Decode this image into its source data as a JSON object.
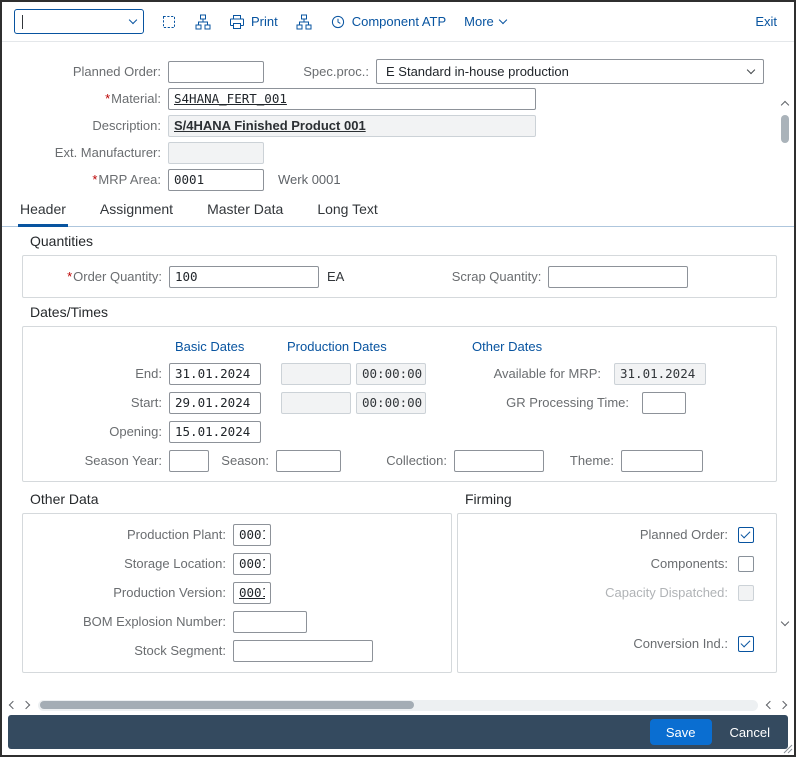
{
  "toolbar": {
    "combobox": {
      "value": ""
    },
    "buttons": {
      "print": "Print",
      "component_atp": "Component ATP",
      "more": "More",
      "exit": "Exit"
    }
  },
  "icons": {
    "toolbar": [
      "dotted-square-icon",
      "hierarchy-icon",
      "printer-icon",
      "hierarchy-icon",
      "clock-icon"
    ],
    "chevron": "chevron-down-icon"
  },
  "header_form": {
    "required_mark": "*",
    "planned_order": {
      "label": "Planned Order:",
      "value": ""
    },
    "spec_proc": {
      "label": "Spec.proc.:",
      "value": "E Standard in-house production"
    },
    "material": {
      "label": "Material:",
      "value": "S4HANA_FERT_001"
    },
    "description": {
      "label": "Description:",
      "value": "S/4HANA Finished Product 001"
    },
    "ext_manufacturer": {
      "label": "Ext. Manufacturer:",
      "value": ""
    },
    "mrp_area": {
      "label": "MRP Area:",
      "value": "0001",
      "plant_text": "Werk 0001"
    }
  },
  "tabs": {
    "items": [
      {
        "label": "Header",
        "selected": true
      },
      {
        "label": "Assignment",
        "selected": false
      },
      {
        "label": "Master Data",
        "selected": false
      },
      {
        "label": "Long Text",
        "selected": false
      }
    ]
  },
  "quantities": {
    "title": "Quantities",
    "order_quantity": {
      "label": "Order Quantity:",
      "value": "100",
      "unit": "EA"
    },
    "scrap_quantity": {
      "label": "Scrap Quantity:",
      "value": ""
    }
  },
  "dates_times": {
    "title": "Dates/Times",
    "col_basic": "Basic Dates",
    "col_production": "Production Dates",
    "col_other": "Other Dates",
    "end": {
      "label": "End:",
      "basic": "31.01.2024",
      "production": "",
      "time": "00:00:00"
    },
    "start": {
      "label": "Start:",
      "basic": "29.01.2024",
      "production": "",
      "time": "00:00:00"
    },
    "opening": {
      "label": "Opening:",
      "basic": "15.01.2024"
    },
    "available_for_mrp": {
      "label": "Available for MRP:",
      "value": "31.01.2024"
    },
    "gr_processing_time": {
      "label": "GR Processing Time:",
      "value": ""
    },
    "season_year": {
      "label": "Season Year:",
      "value": ""
    },
    "season": {
      "label": "Season:",
      "value": ""
    },
    "collection": {
      "label": "Collection:",
      "value": ""
    },
    "theme": {
      "label": "Theme:",
      "value": ""
    }
  },
  "other_data": {
    "title": "Other Data",
    "production_plant": {
      "label": "Production Plant:",
      "value": "0001"
    },
    "storage_location": {
      "label": "Storage Location:",
      "value": "0001"
    },
    "production_version": {
      "label": "Production Version:",
      "value": "0001"
    },
    "bom_explosion_number": {
      "label": "BOM Explosion Number:",
      "value": ""
    },
    "stock_segment": {
      "label": "Stock Segment:",
      "value": ""
    }
  },
  "firming": {
    "title": "Firming",
    "planned_order": {
      "label": "Planned Order:",
      "checked": true
    },
    "components": {
      "label": "Components:",
      "checked": false
    },
    "capacity_dispatched": {
      "label": "Capacity Dispatched:",
      "checked": false,
      "disabled": true
    },
    "conversion_ind": {
      "label": "Conversion Ind.:",
      "checked": true
    }
  },
  "footer": {
    "save": "Save",
    "cancel": "Cancel"
  },
  "colors": {
    "accent": "#0a6ed1",
    "toolbar_icon": "#0854a0",
    "footer_bg": "#344a5f",
    "required": "#bb0000",
    "label": "#6a6d70",
    "readonly_bg": "#f2f3f4"
  }
}
